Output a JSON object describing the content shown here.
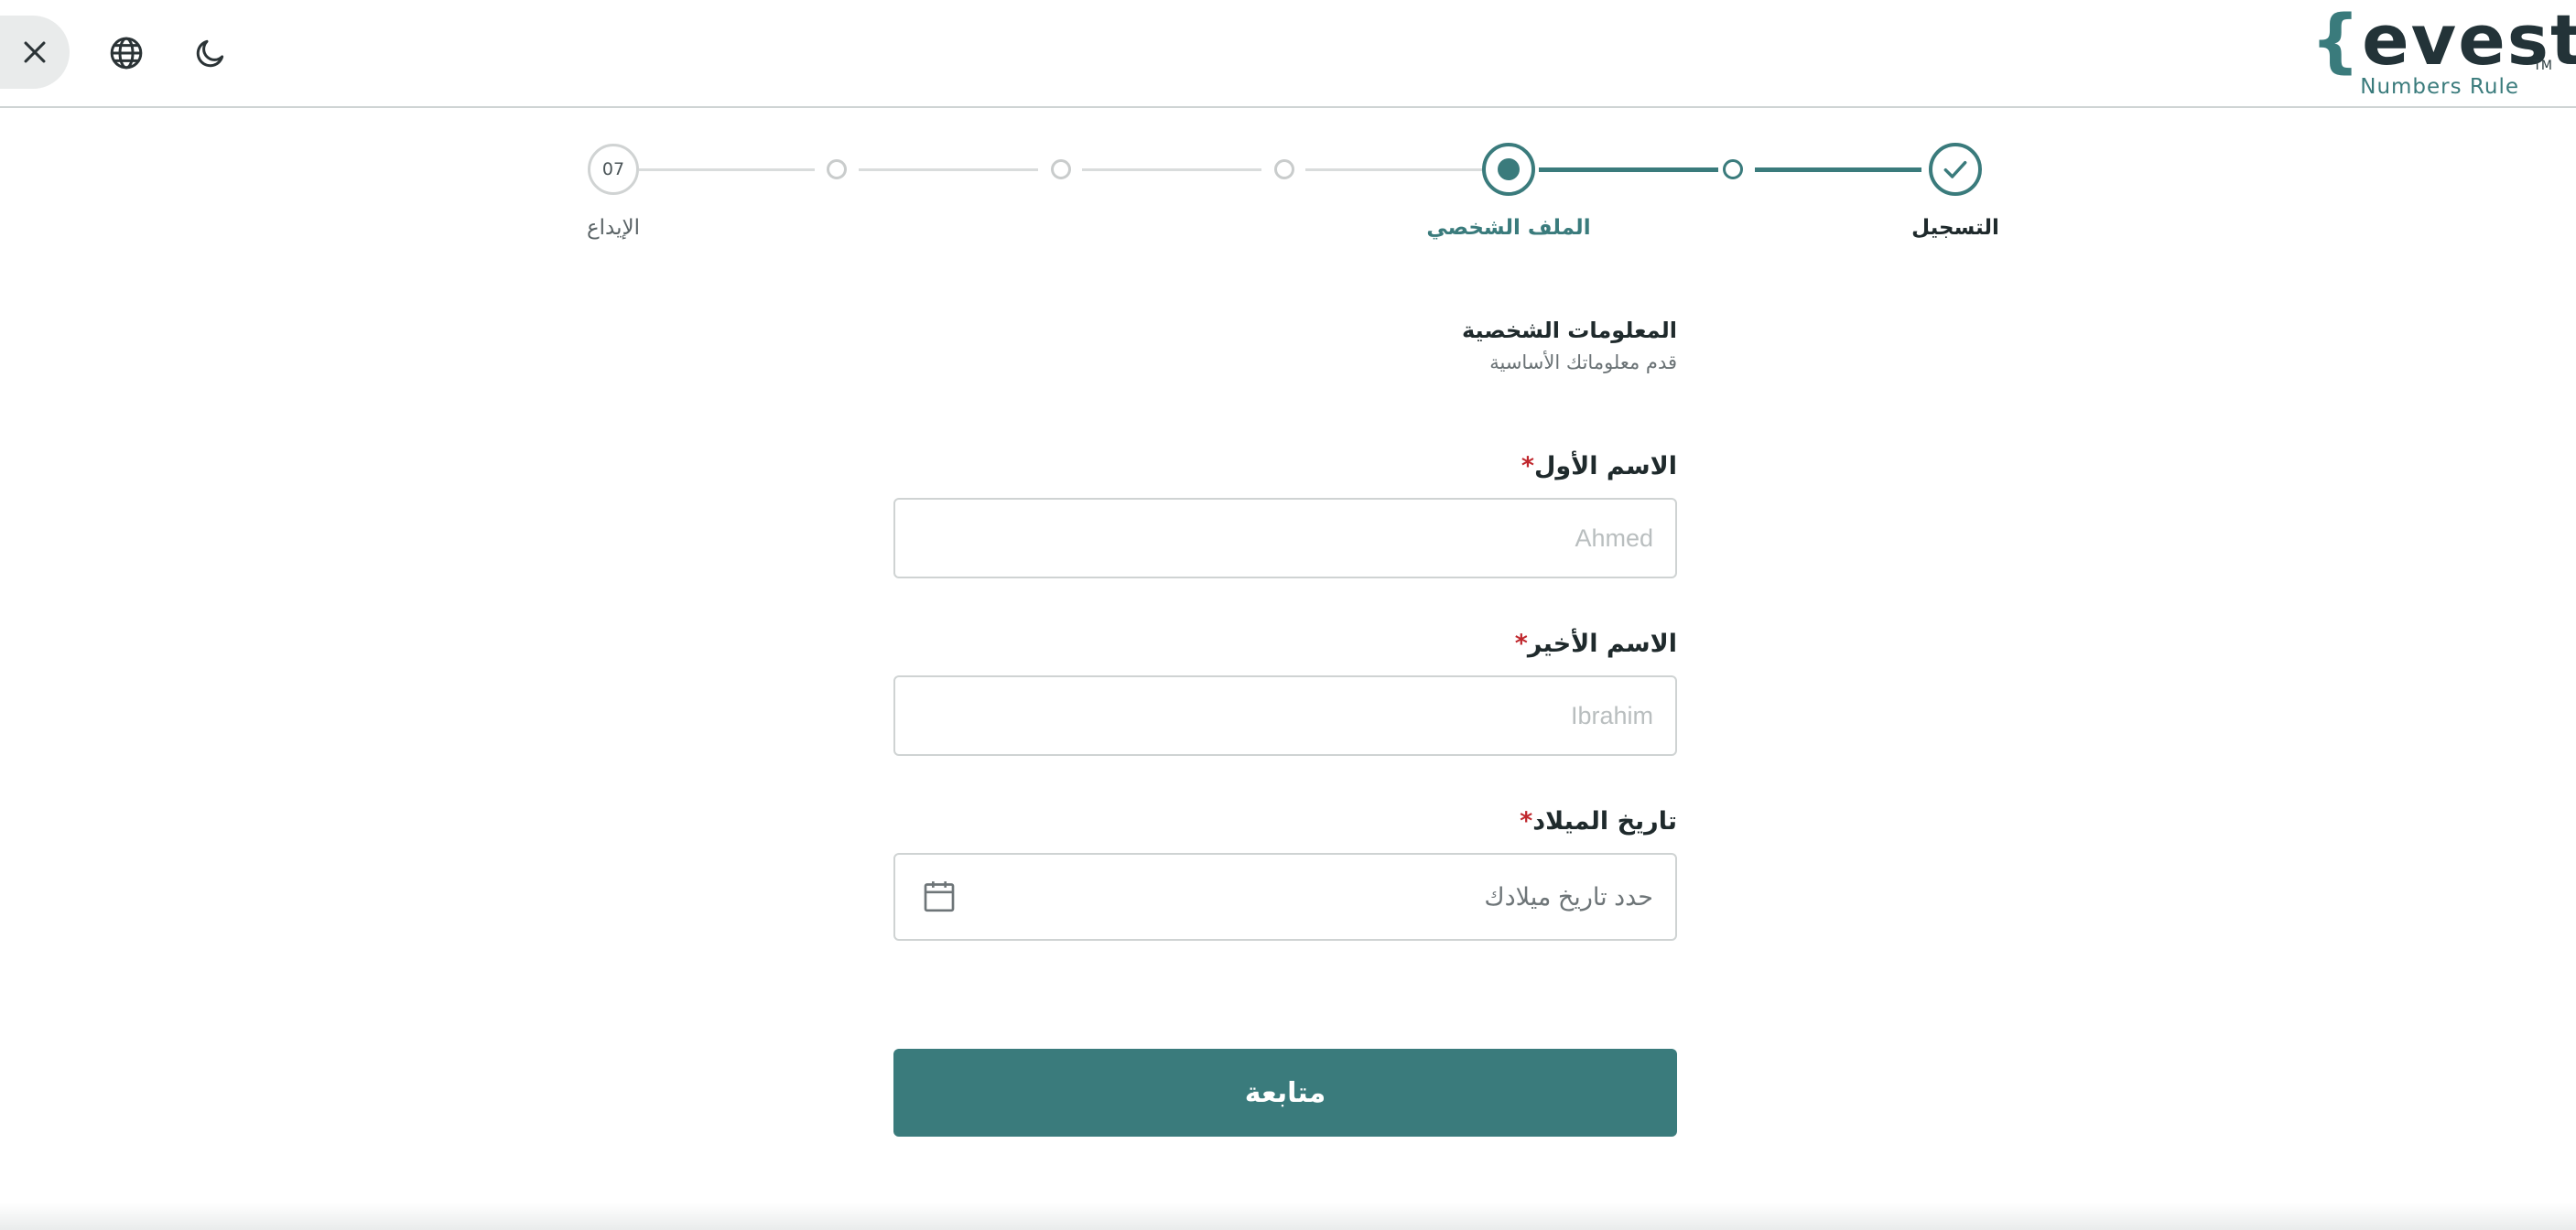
{
  "header": {
    "close_icon": "close-icon",
    "language_icon": "globe-icon",
    "theme_icon": "moon-icon",
    "logo": {
      "brace_open": "{",
      "word": "evest",
      "brace_close": "}",
      "tm": "TM",
      "tagline": "Numbers Rule"
    }
  },
  "stepper": {
    "steps": [
      {
        "label": "التسجيل",
        "state": "done"
      },
      {
        "label": "",
        "state": "done"
      },
      {
        "label": "الملف الشخصي",
        "state": "current"
      },
      {
        "label": "",
        "state": "future"
      },
      {
        "label": "",
        "state": "future"
      },
      {
        "label": "",
        "state": "future"
      },
      {
        "label": "الإيداع",
        "state": "future",
        "number": "07"
      }
    ]
  },
  "form": {
    "title": "المعلومات الشخصية",
    "subtitle": "قدم معلوماتك الأساسية",
    "first_name": {
      "label": "الاسم الأول",
      "required_mark": "*",
      "placeholder": "Ahmed",
      "value": ""
    },
    "last_name": {
      "label": "الاسم الأخير",
      "required_mark": "*",
      "placeholder": "Ibrahim",
      "value": ""
    },
    "birth_date": {
      "label": "تاريخ الميلاد",
      "required_mark": "*",
      "placeholder": "حدد تاريخ ميلادك",
      "value": "",
      "icon": "calendar-icon"
    },
    "submit_label": "متابعة"
  },
  "colors": {
    "accent": "#3a7b7c",
    "required": "#c0272d",
    "inactive": "#c9cccc"
  }
}
